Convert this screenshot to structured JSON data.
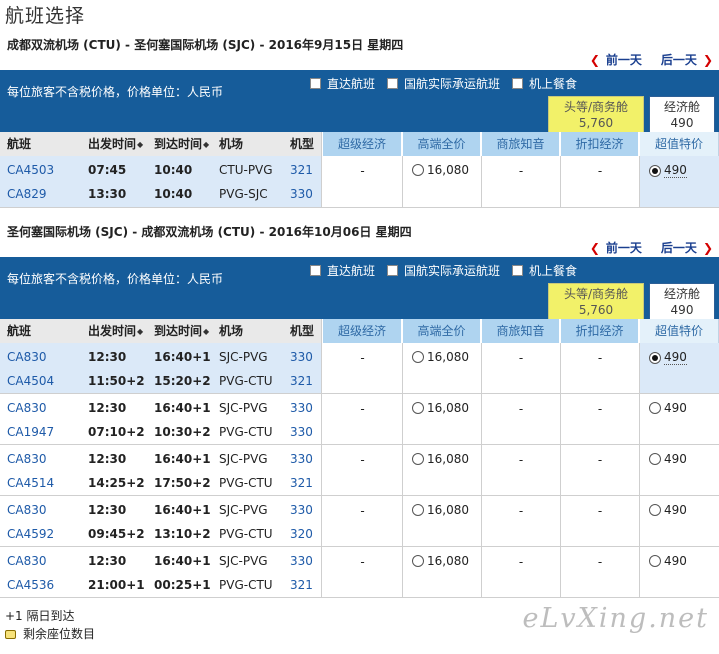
{
  "page_title": "航班选择",
  "outbound": {
    "route": "成都双流机场 (CTU) - 圣何塞国际机场 (SJC) - 2016年9月15日 星期四",
    "prev_day": "前一天",
    "next_day": "后一天",
    "price_note": "每位旅客不含税价格，价格单位：人民币",
    "filters": [
      "直达航班",
      "国航实际承运航班",
      "机上餐食"
    ],
    "cabins": [
      {
        "name": "头等/商务舱",
        "price": "5,760"
      },
      {
        "name": "经济舱",
        "price": "490"
      }
    ],
    "columns": [
      "航班",
      "出发时间",
      "到达时间",
      "机场",
      "机型"
    ],
    "fare_columns": [
      "超级经济",
      "高端全价",
      "商旅知音",
      "折扣经济",
      "超值特价"
    ],
    "groups": [
      {
        "segments": [
          {
            "flight": "CA4503",
            "dep": "07:45",
            "arr": "10:40",
            "airports": "CTU-PVG",
            "aircraft": "321"
          },
          {
            "flight": "CA829",
            "dep": "13:30",
            "arr": "10:40",
            "airports": "PVG-SJC",
            "aircraft": "330"
          }
        ],
        "fares": [
          "-",
          "16,080",
          "-",
          "-",
          "490"
        ]
      }
    ]
  },
  "return": {
    "route": "圣何塞国际机场 (SJC) - 成都双流机场 (CTU) - 2016年10月06日 星期四",
    "prev_day": "前一天",
    "next_day": "后一天",
    "price_note": "每位旅客不含税价格，价格单位：人民币",
    "filters": [
      "直达航班",
      "国航实际承运航班",
      "机上餐食"
    ],
    "cabins": [
      {
        "name": "头等/商务舱",
        "price": "5,760"
      },
      {
        "name": "经济舱",
        "price": "490"
      }
    ],
    "columns": [
      "航班",
      "出发时间",
      "到达时间",
      "机场",
      "机型"
    ],
    "fare_columns": [
      "超级经济",
      "高端全价",
      "商旅知音",
      "折扣经济",
      "超值特价"
    ],
    "groups": [
      {
        "segments": [
          {
            "flight": "CA830",
            "dep": "12:30",
            "arr": "16:40+1",
            "airports": "SJC-PVG",
            "aircraft": "330"
          },
          {
            "flight": "CA4504",
            "dep": "11:50+2",
            "arr": "15:20+2",
            "airports": "PVG-CTU",
            "aircraft": "321"
          }
        ],
        "fares": [
          "-",
          "16,080",
          "-",
          "-",
          "490"
        ]
      },
      {
        "segments": [
          {
            "flight": "CA830",
            "dep": "12:30",
            "arr": "16:40+1",
            "airports": "SJC-PVG",
            "aircraft": "330"
          },
          {
            "flight": "CA1947",
            "dep": "07:10+2",
            "arr": "10:30+2",
            "airports": "PVG-CTU",
            "aircraft": "330"
          }
        ],
        "fares": [
          "-",
          "16,080",
          "-",
          "-",
          "490"
        ]
      },
      {
        "segments": [
          {
            "flight": "CA830",
            "dep": "12:30",
            "arr": "16:40+1",
            "airports": "SJC-PVG",
            "aircraft": "330"
          },
          {
            "flight": "CA4514",
            "dep": "14:25+2",
            "arr": "17:50+2",
            "airports": "PVG-CTU",
            "aircraft": "321"
          }
        ],
        "fares": [
          "-",
          "16,080",
          "-",
          "-",
          "490"
        ]
      },
      {
        "segments": [
          {
            "flight": "CA830",
            "dep": "12:30",
            "arr": "16:40+1",
            "airports": "SJC-PVG",
            "aircraft": "330"
          },
          {
            "flight": "CA4592",
            "dep": "09:45+2",
            "arr": "13:10+2",
            "airports": "PVG-CTU",
            "aircraft": "320"
          }
        ],
        "fares": [
          "-",
          "16,080",
          "-",
          "-",
          "490"
        ]
      },
      {
        "segments": [
          {
            "flight": "CA830",
            "dep": "12:30",
            "arr": "16:40+1",
            "airports": "SJC-PVG",
            "aircraft": "330"
          },
          {
            "flight": "CA4536",
            "dep": "21:00+1",
            "arr": "00:25+1",
            "airports": "PVG-CTU",
            "aircraft": "321"
          }
        ],
        "fares": [
          "-",
          "16,080",
          "-",
          "-",
          "490"
        ]
      }
    ]
  },
  "legend": {
    "next_day_note": "+1 隔日到达",
    "seats_note": "剩余座位数目"
  },
  "watermark": "eLvXing.net"
}
